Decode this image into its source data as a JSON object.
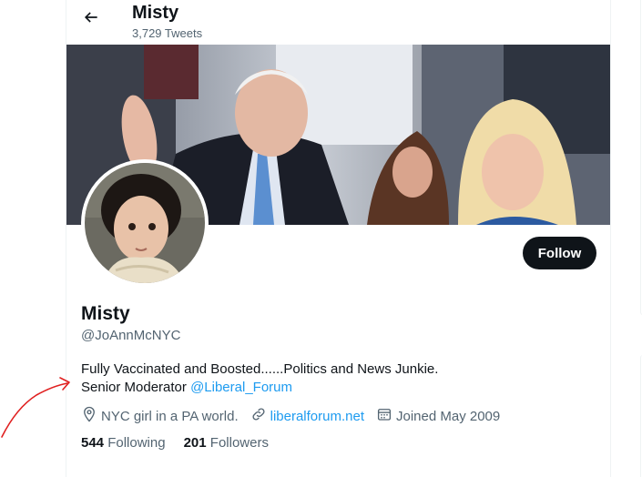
{
  "header": {
    "name": "Misty",
    "tweet_count": "3,729 Tweets"
  },
  "profile": {
    "display_name": "Misty",
    "handle": "@JoAnnMcNYC",
    "follow_label": "Follow",
    "bio_line1": "Fully Vaccinated and Boosted......Politics and News Junkie.",
    "bio_line2_prefix": "Senior Moderator ",
    "bio_mention": "@Liberal_Forum",
    "location": "NYC girl in a PA world.",
    "website": "liberalforum.net",
    "joined": "Joined May 2009",
    "following_count": "544",
    "following_label": "Following",
    "followers_count": "201",
    "followers_label": "Followers"
  },
  "icons": {
    "back": "arrow-left-icon",
    "location": "location-pin-icon",
    "website": "link-icon",
    "joined": "calendar-icon"
  },
  "colors": {
    "accent": "#1d9bf0",
    "text": "#0f1419",
    "secondary": "#536471",
    "follow_bg": "#0f1419",
    "annotation": "#e02020"
  }
}
